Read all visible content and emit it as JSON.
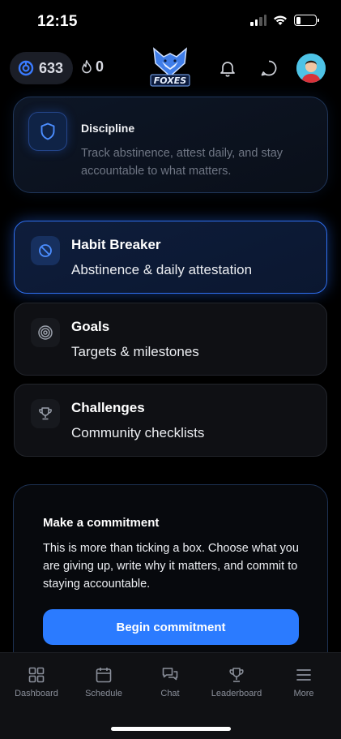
{
  "status_bar": {
    "time": "12:15"
  },
  "top_nav": {
    "points": "633",
    "streak": "0",
    "logo_text": "FOXES"
  },
  "discipline": {
    "title": "Discipline",
    "description": "Track abstinence, attest daily, and stay accountable to what matters.",
    "icon": "shield-icon"
  },
  "menu": [
    {
      "title": "Habit Breaker",
      "subtitle": "Abstinence & daily attestation",
      "icon": "ban-icon",
      "active": true
    },
    {
      "title": "Goals",
      "subtitle": "Targets & milestones",
      "icon": "target-icon",
      "active": false
    },
    {
      "title": "Challenges",
      "subtitle": "Community checklists",
      "icon": "trophy-icon",
      "active": false
    }
  ],
  "commitment": {
    "title": "Make a commitment",
    "description": "This is more than ticking a box. Choose what you are giving up, write why it matters, and commit to staying accountable.",
    "button_label": "Begin commitment"
  },
  "tabs": [
    {
      "label": "Dashboard",
      "icon": "grid-icon"
    },
    {
      "label": "Schedule",
      "icon": "calendar-icon"
    },
    {
      "label": "Chat",
      "icon": "chat-bubbles-icon"
    },
    {
      "label": "Leaderboard",
      "icon": "trophy-icon"
    },
    {
      "label": "More",
      "icon": "menu-icon"
    }
  ],
  "colors": {
    "accent": "#2b7bff",
    "background": "#000000",
    "card": "#0f1014",
    "muted_text": "#6f7684"
  }
}
